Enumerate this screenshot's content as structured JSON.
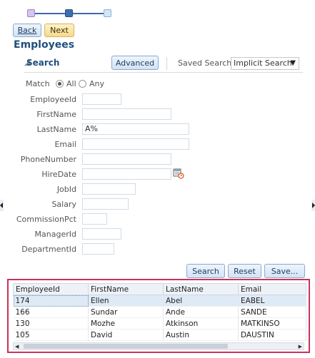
{
  "train": {
    "steps": 3,
    "current": 2
  },
  "nav": {
    "back": "Back",
    "next": "Next"
  },
  "page_title": "Employees",
  "search": {
    "header": "Search",
    "advanced": "Advanced",
    "saved_search_label": "Saved Search",
    "saved_search_value": "Implicit Search",
    "match_label": "Match",
    "match_all": "All",
    "match_any": "Any",
    "fields": [
      {
        "label": "EmployeeId",
        "value": ""
      },
      {
        "label": "FirstName",
        "value": ""
      },
      {
        "label": "LastName",
        "value": "A%"
      },
      {
        "label": "Email",
        "value": ""
      },
      {
        "label": "PhoneNumber",
        "value": ""
      },
      {
        "label": "HireDate",
        "value": ""
      },
      {
        "label": "JobId",
        "value": ""
      },
      {
        "label": "Salary",
        "value": ""
      },
      {
        "label": "CommissionPct",
        "value": ""
      },
      {
        "label": "ManagerId",
        "value": ""
      },
      {
        "label": "DepartmentId",
        "value": ""
      }
    ],
    "search_btn": "Search",
    "reset_btn": "Reset",
    "save_btn": "Save..."
  },
  "results": {
    "columns": [
      "EmployeeId",
      "FirstName",
      "LastName",
      "Email"
    ],
    "rows": [
      [
        "174",
        "Ellen",
        "Abel",
        "EABEL"
      ],
      [
        "166",
        "Sundar",
        "Ande",
        "SANDE"
      ],
      [
        "130",
        "Mozhe",
        "Atkinson",
        "MATKINSO"
      ],
      [
        "105",
        "David",
        "Austin",
        "DAUSTIN"
      ]
    ],
    "selected_row": 0
  },
  "colors": {
    "accent": "#1f4f7c",
    "highlight_border": "#c8335b",
    "selected_row": "#dfeaf7"
  }
}
